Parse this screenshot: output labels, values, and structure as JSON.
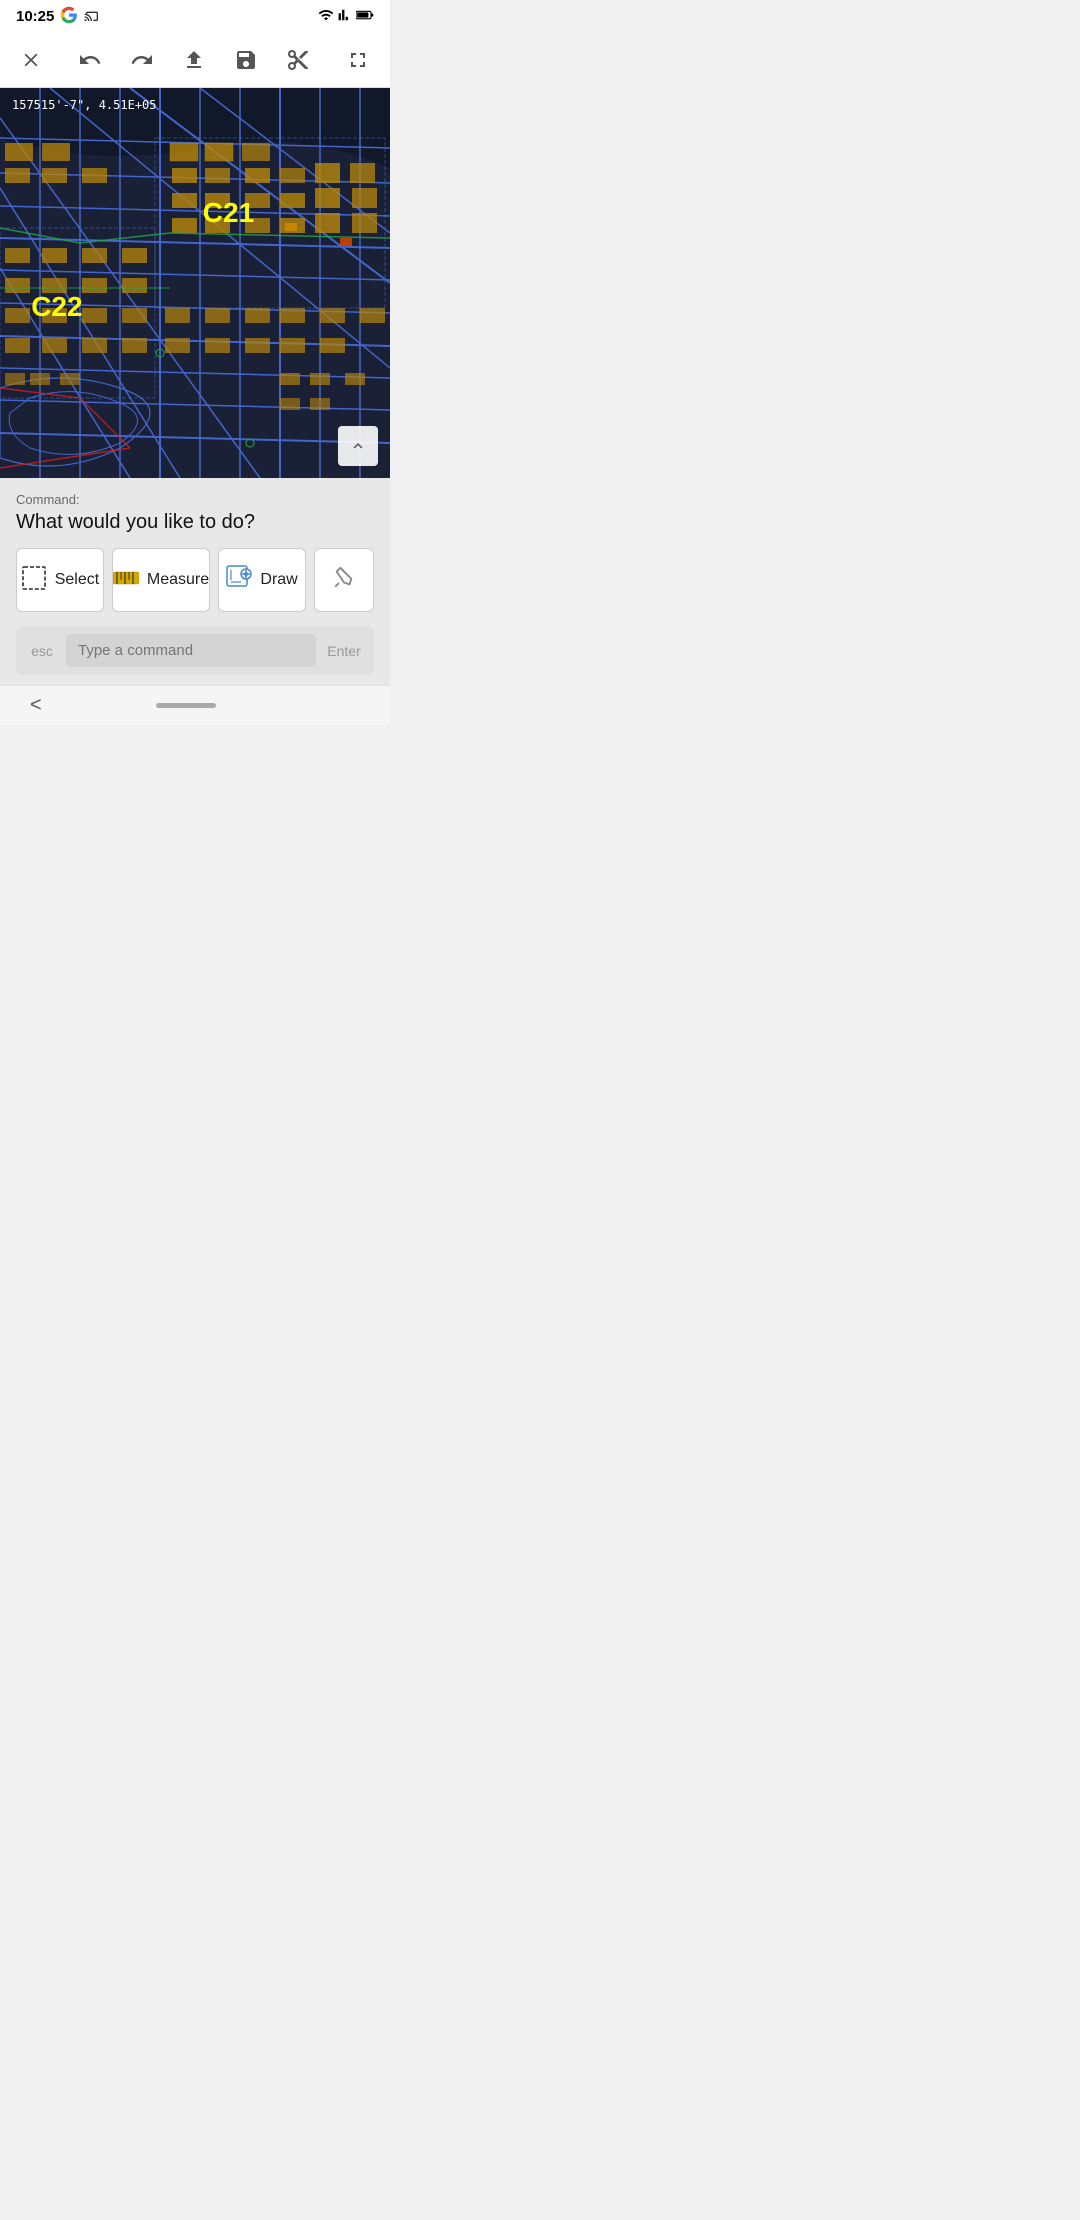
{
  "statusBar": {
    "time": "10:25",
    "icons": [
      "G",
      "screen-cast",
      "wifi",
      "signal",
      "battery"
    ]
  },
  "toolbar": {
    "close_label": "×",
    "undo_label": "↩",
    "redo_label": "↪",
    "share_label": "↑",
    "save_label": "💾",
    "scissors_label": "✂",
    "fullscreen_label": "⤢"
  },
  "map": {
    "coordinates": "157515'-7\", 4.51E+05",
    "zones": [
      {
        "id": "C21",
        "label": "C21"
      },
      {
        "id": "C22",
        "label": "C22"
      }
    ],
    "expand_tooltip": "expand"
  },
  "command": {
    "prefix": "Command:",
    "question": "What would you like to do?",
    "actions": [
      {
        "id": "select",
        "icon": "⬚",
        "label": "Select"
      },
      {
        "id": "measure",
        "icon": "📏",
        "label": "Measure"
      },
      {
        "id": "draw",
        "icon": "🖊",
        "label": "Draw"
      }
    ],
    "more_label": "…",
    "input_placeholder": "Type a command",
    "esc_label": "esc",
    "enter_label": "Enter"
  },
  "bottomBar": {
    "back_label": "<",
    "home_indicator": ""
  }
}
